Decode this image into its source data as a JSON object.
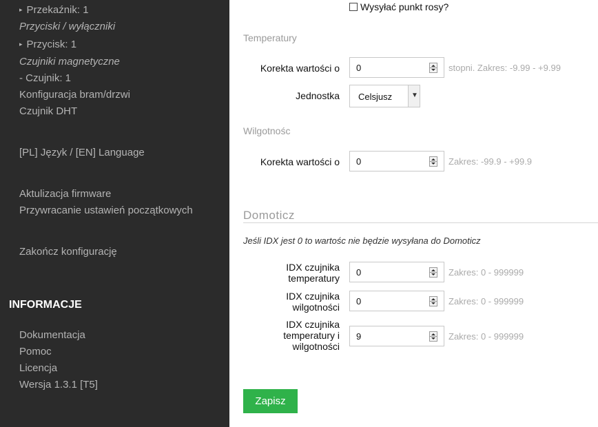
{
  "sidebar": {
    "items": [
      {
        "label": "Przekaźnik: 1",
        "arrow": "▸"
      },
      {
        "label": "Przyciski / wyłączniki"
      },
      {
        "label": "Przycisk: 1",
        "arrow": "▸"
      },
      {
        "label": "Czujniki magnetyczne"
      },
      {
        "label": "- Czujnik: 1"
      },
      {
        "label": "Konfiguracja bram/drzwi"
      },
      {
        "label": "Czujnik DHT"
      },
      {
        "label": "[PL] Język / [EN] Language"
      },
      {
        "label": "Aktulizacja firmware"
      },
      {
        "label": "Przywracanie ustawień początkowych"
      },
      {
        "label": "Zakończ konfigurację"
      }
    ],
    "info_heading": "INFORMACJE",
    "info_items": [
      {
        "label": "Dokumentacja"
      },
      {
        "label": "Pomoc"
      },
      {
        "label": "Licencja"
      },
      {
        "label": "Wersja 1.3.1 [T5]"
      }
    ]
  },
  "main": {
    "dew_point_label": "Wysyłać punkt rosy?",
    "dew_point_checked": false,
    "temperature": {
      "section": "Temperatury",
      "correction_label": "Korekta wartości o",
      "correction_value": "0",
      "correction_hint": "stopni. Zakres: -9.99 - +9.99",
      "unit_label": "Jednostka",
      "unit_value": "Celsjusz"
    },
    "humidity": {
      "section": "Wilgotnośc",
      "correction_label": "Korekta wartości o",
      "correction_value": "0",
      "correction_hint": "Zakres: -99.9 - +99.9"
    },
    "domoticz": {
      "title": "Domoticz",
      "note": "Jeśli IDX jest 0 to wartośc nie będzie wysyłana do Domoticz",
      "idx_temp_label_1": "IDX czujnika",
      "idx_temp_label_2": "temperatury",
      "idx_temp_value": "0",
      "idx_temp_hint": "Zakres: 0 - 999999",
      "idx_hum_label_1": "IDX czujnika",
      "idx_hum_label_2": "wilgotności",
      "idx_hum_value": "0",
      "idx_hum_hint": "Zakres: 0 - 999999",
      "idx_both_label_1": "IDX czujnika",
      "idx_both_label_2": "temperatury i",
      "idx_both_label_3": "wilgotności",
      "idx_both_value": "9",
      "idx_both_hint": "Zakres: 0 - 999999"
    },
    "save_label": "Zapisz"
  },
  "colors": {
    "sidebar_bg": "#2b2b2b",
    "sidebar_text": "#b4b4b4",
    "save_button": "#2fb24a"
  }
}
